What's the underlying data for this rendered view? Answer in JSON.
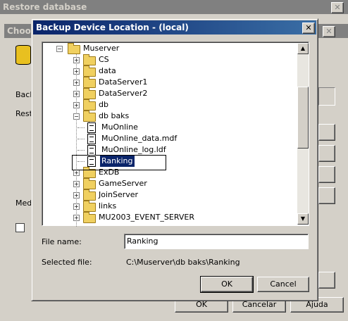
{
  "background_window": {
    "title": "Restore database",
    "inner_title": "Choos",
    "labels": {
      "back": "Back",
      "rest": "Resto",
      "media": "Medi"
    },
    "buttons": {
      "ok": "OK",
      "cancel": "Cancelar",
      "help": "Ajuda"
    }
  },
  "dialog": {
    "title": "Backup Device Location - (local)",
    "close_glyph": "✕",
    "tree": {
      "root": "Muserver",
      "items": [
        {
          "label": "CS",
          "expander": "+"
        },
        {
          "label": "data",
          "expander": "+"
        },
        {
          "label": "DataServer1",
          "expander": "+"
        },
        {
          "label": "DataServer2",
          "expander": "+"
        },
        {
          "label": "db",
          "expander": "+"
        },
        {
          "label": "db baks",
          "expander": "−"
        },
        {
          "label": "MuOnline",
          "type": "file"
        },
        {
          "label": "MuOnline_data.mdf",
          "type": "file"
        },
        {
          "label": "MuOnline_log.ldf",
          "type": "file"
        },
        {
          "label": "Ranking",
          "type": "file",
          "selected": true
        },
        {
          "label": "ExDB",
          "expander": "+"
        },
        {
          "label": "GameServer",
          "expander": "+"
        },
        {
          "label": "JoinServer",
          "expander": "+"
        },
        {
          "label": "links",
          "expander": "+"
        },
        {
          "label": "MU2003_EVENT_SERVER",
          "expander": "+"
        }
      ]
    },
    "file_name_label": "File name:",
    "file_name_value": "Ranking",
    "selected_file_label": "Selected file:",
    "selected_file_value": "C:\\Muserver\\db baks\\Ranking",
    "ok_label": "OK",
    "cancel_label": "Cancel"
  },
  "colors": {
    "title_active": "#0a246a",
    "title_inactive": "#808080",
    "selection": "#0a246a",
    "face": "#d4d0c8"
  }
}
